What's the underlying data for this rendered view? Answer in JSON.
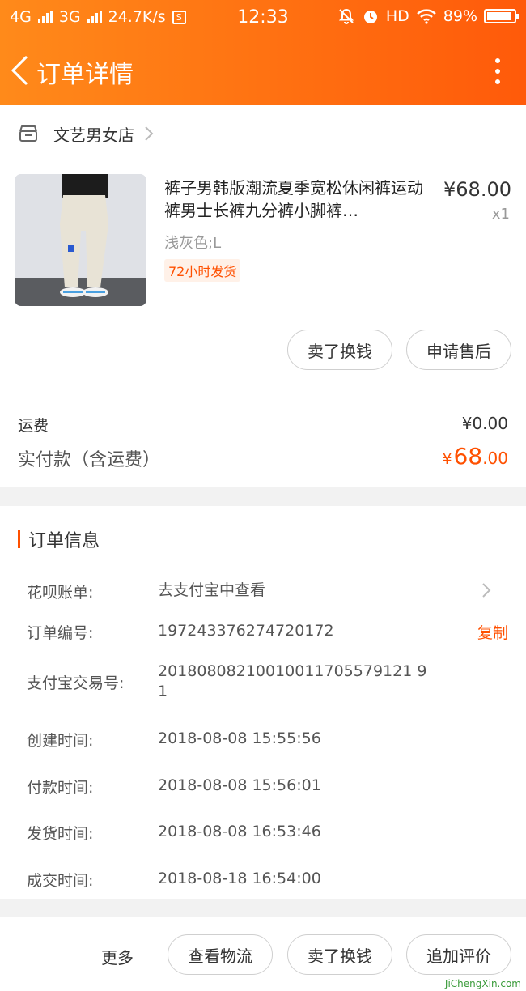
{
  "status_bar": {
    "network1": "4G",
    "network2": "3G",
    "speed": "24.7K/s",
    "sim_glyph": "S",
    "time": "12:33",
    "hd": "HD",
    "battery": "89%"
  },
  "nav": {
    "title": "订单详情"
  },
  "shop": {
    "name": "文艺男女店"
  },
  "product": {
    "title": "裤子男韩版潮流夏季宽松休闲裤运动裤男士长裤九分裤小脚裤…",
    "price": "¥68.00",
    "quantity": "x1",
    "variant": "浅灰色;L",
    "tag": "72小时发货"
  },
  "item_actions": {
    "sell_label": "卖了换钱",
    "aftersale_label": "申请售后"
  },
  "summary": {
    "freight_label": "运费",
    "freight_value": "¥0.00",
    "paid_label": "实付款（含运费）",
    "paid_currency": "¥",
    "paid_integer": "68",
    "paid_decimal": ".00"
  },
  "order_info": {
    "title": "订单信息",
    "huabei_label": "花呗账单:",
    "huabei_value": "去支付宝中查看",
    "order_no_label": "订单编号:",
    "order_no_value": "197243376274720172",
    "copy_label": "复制",
    "alipay_label": "支付宝交易号:",
    "alipay_value": "20180808210010011705579121 91",
    "created_label": "创建时间:",
    "created_value": "2018-08-08 15:55:56",
    "paid_label": "付款时间:",
    "paid_value": "2018-08-08 15:56:01",
    "shipped_label": "发货时间:",
    "shipped_value": "2018-08-08 16:53:46",
    "closed_label": "成交时间:",
    "closed_value": "2018-08-18 16:54:00"
  },
  "bottom_bar": {
    "more_label": "更多",
    "logistics_label": "查看物流",
    "sell_label": "卖了换钱",
    "review_label": "追加评价"
  },
  "watermark": {
    "text": "JiChengXin.com"
  },
  "colors": {
    "accent": "#ff5000",
    "header_start": "#ff8a1a",
    "header_end": "#ff5a0a"
  }
}
